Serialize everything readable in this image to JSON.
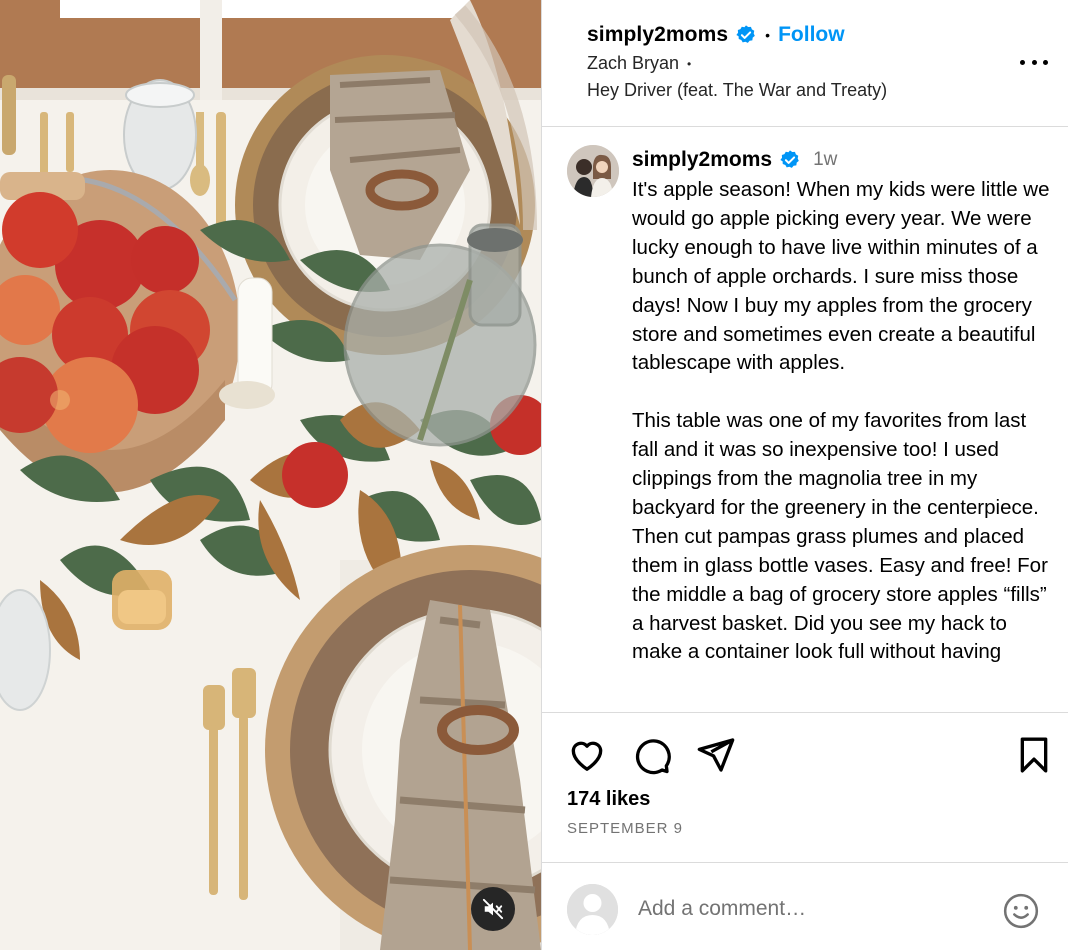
{
  "header": {
    "username": "simply2moms",
    "separator": "•",
    "follow_label": "Follow",
    "artist": "Zach Bryan",
    "artist_separator": "•",
    "song": "Hey Driver (feat. The War and Treaty)"
  },
  "caption": {
    "username": "simply2moms",
    "time": "1w",
    "paragraphs": [
      "It's apple season! When my kids were little we would go apple picking every year. We were lucky enough to have live within minutes of a bunch of apple orchards. I sure miss those days! Now I buy my apples from the grocery store and sometimes even create a beautiful tablescape with apples.",
      "This table was one of my favorites from last fall and it was so inexpensive too! I used clippings from the magnolia tree in my backyard for the greenery in the centerpiece. Then cut pampas grass plumes and placed them in glass bottle vases. Easy and free! For the middle a bag of grocery store apples “fills” a harvest basket. Did you see my hack to make a container look full without having"
    ]
  },
  "engagement": {
    "likes": "174 likes",
    "date": "SEPTEMBER 9"
  },
  "comment": {
    "placeholder": "Add a comment…"
  },
  "icons": {
    "verified": "verified-badge-icon",
    "more": "more-options-icon",
    "like": "heart-icon",
    "comment": "comment-bubble-icon",
    "share": "paper-plane-icon",
    "save": "bookmark-icon",
    "mute": "speaker-muted-icon",
    "emoji": "smiley-icon"
  },
  "colors": {
    "accent": "#0095f6",
    "muted_text": "#737373",
    "border": "#dbdbdb"
  }
}
